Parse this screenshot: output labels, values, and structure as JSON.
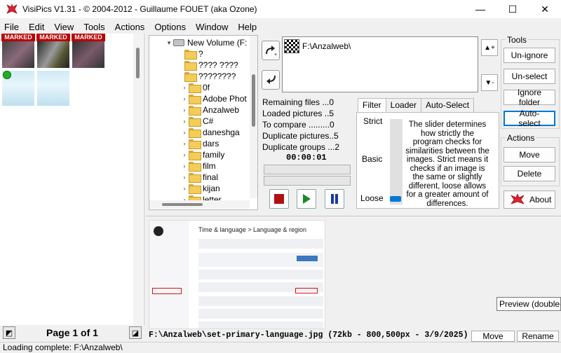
{
  "window": {
    "title": "VisiPics V1.31 - © 2004-2012 - Guillaume FOUET (aka Ozone)",
    "minimize": "—",
    "maximize": "☐",
    "close": "✕"
  },
  "menu": [
    "File",
    "Edit",
    "View",
    "Tools",
    "Actions",
    "Options",
    "Window",
    "Help"
  ],
  "thumbnails": {
    "marked_label": "MARKED",
    "marked_count": 3,
    "unmarked_count": 2
  },
  "page_nav": {
    "label": "Page 1 of 1"
  },
  "tree": {
    "drive": "New Volume (F:",
    "items": [
      "?",
      "???? ????",
      "????????",
      "0f",
      "Adobe Phot",
      "Anzalweb",
      "C#",
      "daneshga",
      "dars",
      "family",
      "film",
      "final",
      "kijan",
      "letter"
    ]
  },
  "folder_list": {
    "entry": "F:\\Anzalweb\\"
  },
  "stats": {
    "remaining": "Remaining files ...0",
    "loaded": "Loaded pictures ..5",
    "to_compare": "To compare .........0",
    "duplicates": "Duplicate pictures..5",
    "groups": "Duplicate groups ...2",
    "timer": "00:00:01"
  },
  "tabs": [
    "Filter",
    "Loader",
    "Auto-Select"
  ],
  "filter": {
    "strict": "Strict",
    "basic": "Basic",
    "loose": "Loose",
    "description": "The slider determines how strictly the program checks for similarities between the images. Strict means it checks if an image is the same or slightly different, loose allows for a greater amount of differences."
  },
  "tools": {
    "label": "Tools",
    "unignore": "Un-ignore",
    "unselect": "Un-select",
    "ignore_folder": "Ignore folder",
    "auto_select": "Auto-select"
  },
  "actions": {
    "label": "Actions",
    "move": "Move",
    "delete": "Delete",
    "about": "About"
  },
  "preview": {
    "tooltip": "Preview (double-",
    "breadcrumb": "Time & language > Language & region"
  },
  "file_info": {
    "text": "F:\\Anzalweb\\set-primary-language.jpg (72kb - 800,500px - 3/9/2025)",
    "move": "Move",
    "rename": "Rename"
  },
  "status": "Loading complete: F:\\Anzalweb\\",
  "colors": {
    "accent": "#0078d7",
    "marked": "#bb0000",
    "stop": "#b01010",
    "play": "#1a8a2a",
    "pause": "#1a3aa0"
  }
}
